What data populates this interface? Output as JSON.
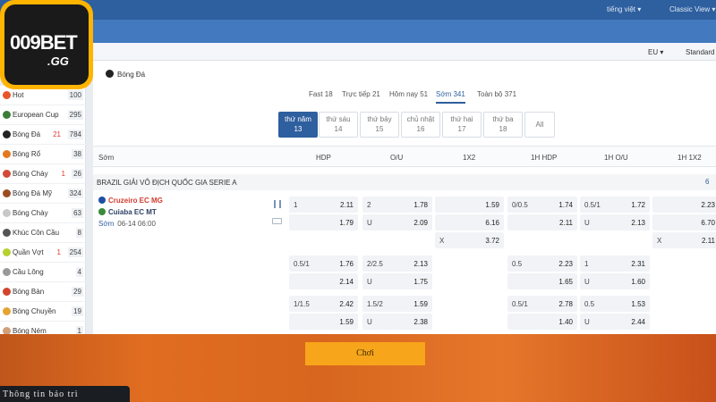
{
  "topbar": {
    "lang": "tiếng việt ▾",
    "view": "Classic View ▾"
  },
  "subbar": {
    "odds_format": "EU ▾",
    "market_view": "Standard"
  },
  "logo": {
    "text1": "009BET",
    "text2": ".GG"
  },
  "breadcrumb": "Bóng Đá",
  "sidebar": [
    {
      "label": "Hot",
      "badge": "100",
      "icon": "fire-icon",
      "color": "#e8552a"
    },
    {
      "label": "European Cup",
      "badge": "295",
      "icon": "euro-cup-icon",
      "color": "#3a7d3a"
    },
    {
      "label": "Bóng Đá",
      "live": "21",
      "badge": "784",
      "icon": "soccer-ball-icon",
      "color": "#222"
    },
    {
      "label": "Bóng Rổ",
      "badge": "38",
      "icon": "basketball-icon",
      "color": "#e37a1f"
    },
    {
      "label": "Bóng Chày",
      "live": "1",
      "badge": "26",
      "icon": "baseball-icon",
      "color": "#d24a3a"
    },
    {
      "label": "Bóng Đá Mỹ",
      "badge": "324",
      "icon": "american-football-icon",
      "color": "#9b4d22"
    },
    {
      "label": "Bóng Chày",
      "badge": "63",
      "icon": "baseball-icon",
      "color": "#c8c8c8"
    },
    {
      "label": "Khúc Côn Cầu",
      "badge": "8",
      "icon": "hockey-icon",
      "color": "#555"
    },
    {
      "label": "Quần Vợt",
      "live": "1",
      "badge": "254",
      "icon": "tennis-icon",
      "color": "#b5d12e"
    },
    {
      "label": "Cầu Lông",
      "badge": "4",
      "icon": "badminton-icon",
      "color": "#999"
    },
    {
      "label": "Bóng Bàn",
      "badge": "29",
      "icon": "table-tennis-icon",
      "color": "#d2452f"
    },
    {
      "label": "Bóng Chuyền",
      "badge": "19",
      "icon": "volleyball-icon",
      "color": "#e5a431"
    },
    {
      "label": "Bóng Ném",
      "badge": "1",
      "icon": "handball-icon",
      "color": "#d0a07a"
    }
  ],
  "tabs": [
    {
      "label": "Fast 18"
    },
    {
      "label": "Trực tiếp 21"
    },
    {
      "label": "Hôm nay 51"
    },
    {
      "label": "Sớm 341",
      "active": true
    },
    {
      "label": "Toàn bộ 371"
    }
  ],
  "days": [
    {
      "day": "thứ năm",
      "date": "13",
      "active": true
    },
    {
      "day": "thứ sáu",
      "date": "14"
    },
    {
      "day": "thứ bảy",
      "date": "15"
    },
    {
      "day": "chủ nhật",
      "date": "16"
    },
    {
      "day": "thứ hai",
      "date": "17"
    },
    {
      "day": "thứ ba",
      "date": "18"
    },
    {
      "day": "All",
      "date": ""
    }
  ],
  "table_header": {
    "col0": "Sớm",
    "hdp": "HDP",
    "ou": "O/U",
    "x12": "1X2",
    "h1hdp": "1H HDP",
    "h1ou": "1H O/U",
    "h1x12": "1H 1X2"
  },
  "league": {
    "name": "BRAZIL GIẢI VÔ ĐỊCH QUỐC GIA SERIE A",
    "count": "6"
  },
  "match": {
    "home": "Cruzeiro EC MG",
    "away": "Cuiaba EC MT",
    "status": "Sớm",
    "datetime": "06-14 06:00"
  },
  "odds_row1": {
    "hdp": [
      [
        "1",
        "2.11"
      ],
      [
        "",
        "1.79"
      ]
    ],
    "ou": [
      [
        "2",
        "1.78"
      ],
      [
        "U",
        "2.09"
      ]
    ],
    "x12": [
      [
        "",
        "1.59"
      ],
      [
        "",
        "6.16"
      ],
      [
        "X",
        "3.72"
      ]
    ],
    "h1hdp": [
      [
        "0/0.5",
        "1.74"
      ],
      [
        "",
        "2.11"
      ]
    ],
    "h1ou": [
      [
        "0.5/1",
        "1.72"
      ],
      [
        "U",
        "2.13"
      ]
    ],
    "h1x12": [
      [
        "",
        "2.23"
      ],
      [
        "",
        "6.70"
      ],
      [
        "X",
        "2.11"
      ]
    ]
  },
  "odds_row2": {
    "hdp": [
      [
        "0.5/1",
        "1.76"
      ],
      [
        "",
        "2.14"
      ]
    ],
    "ou": [
      [
        "2/2.5",
        "2.13"
      ],
      [
        "U",
        "1.75"
      ]
    ],
    "h1hdp": [
      [
        "0.5",
        "2.23"
      ],
      [
        "",
        "1.65"
      ]
    ],
    "h1ou": [
      [
        "1",
        "2.31"
      ],
      [
        "U",
        "1.60"
      ]
    ]
  },
  "odds_row3": {
    "hdp": [
      [
        "1/1.5",
        "2.42"
      ],
      [
        "",
        "1.59"
      ]
    ],
    "ou": [
      [
        "1.5/2",
        "1.59"
      ],
      [
        "U",
        "2.38"
      ]
    ],
    "h1hdp": [
      [
        "0.5/1",
        "2.78"
      ],
      [
        "",
        "1.40"
      ]
    ],
    "h1ou": [
      [
        "0.5",
        "1.53"
      ],
      [
        "U",
        "2.44"
      ]
    ]
  },
  "banner": {
    "play_label": "Chơi",
    "maintenance": "Thông tin bảo trì"
  }
}
